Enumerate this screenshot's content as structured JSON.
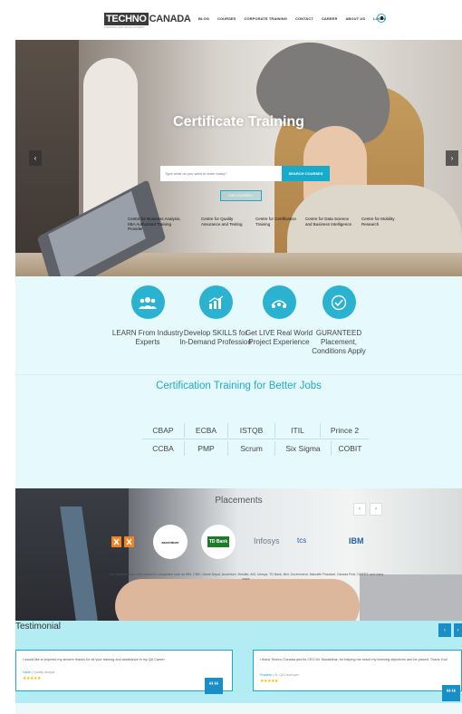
{
  "header": {
    "logo_part1": "TECHNO",
    "logo_part2": "CANADA",
    "logo_tagline": "TRAINING AND DEVELOPMENT",
    "nav": [
      "BLOG",
      "COURSES",
      "CORPORATE TRAINING",
      "CONTACT",
      "CAREER",
      "ABOUT US",
      "LOGIN"
    ]
  },
  "hero": {
    "title": "Certificate Training",
    "search_placeholder": "Type what do you want to learn today?",
    "search_button": "SEARCH COURSES",
    "courses_button": "OUR COURSES ›",
    "prev_arrow": "‹",
    "next_arrow": "›",
    "items": [
      "Centre for Business Analysis, IIBA Authorized Training Provider",
      "Centre for Quality Assurance and Testing",
      "Centre for Certification Training",
      "Centre for Data Science and Business Intelligence",
      "Centre for Mobility Research"
    ]
  },
  "features": [
    {
      "icon": "group-icon",
      "label": "LEARN From Industry Experts"
    },
    {
      "icon": "chart-icon",
      "label": "Develop SKILLS for In-Demand Profession"
    },
    {
      "icon": "project-icon",
      "label": "Get LIVE Real World Project Experience"
    },
    {
      "icon": "badge-check-icon",
      "label": "GURANTEED Placement, Conditions Apply"
    }
  ],
  "certification": {
    "title": "Certification Training for Better Jobs",
    "row1": [
      "CBAP",
      "ECBA",
      "ISTQB",
      "ITIL",
      "Prince 2"
    ],
    "row2": [
      "CCBA",
      "PMP",
      "Scrum",
      "Six Sigma",
      "COBIT"
    ]
  },
  "placements": {
    "title": "Placements",
    "prev": "‹",
    "next": "›",
    "logos": [
      "accenture",
      "TD Bank",
      "Infosys",
      "tcs",
      "IBM"
    ],
    "caption": "Our students have been placed in companies such as IBM, CIBC, Home Depot, Accenture, Deloitte, AIG, Infosys, TD Bank, Bell, Government, Manulife Financial, Canada Post, OMERS and many more."
  },
  "testimonial": {
    "title": "Testimonial",
    "prev": "‹",
    "next": "›",
    "quote_mark": "““",
    "cards": [
      {
        "text": "I would like to express my sincere thanks for all your training and assistance in my QA Career.",
        "name": "Harsh",
        "role": "Quality Analyst",
        "stars": "★★★★★"
      },
      {
        "text": "I thank Techno Canada and its CEO Mr. Muralidhar, for helping me reach my learning objectives and be placed. Thank You!",
        "name": "Pradeep",
        "role": "Sr. QA Developer",
        "stars": "★★★★★"
      }
    ]
  },
  "colors": {
    "accent": "#18aaca",
    "feature_bg": "#e6f9fc",
    "testimonial_bg": "#b3ecf2",
    "quote_blue": "#1a8fc7",
    "star": "#f5b800"
  }
}
